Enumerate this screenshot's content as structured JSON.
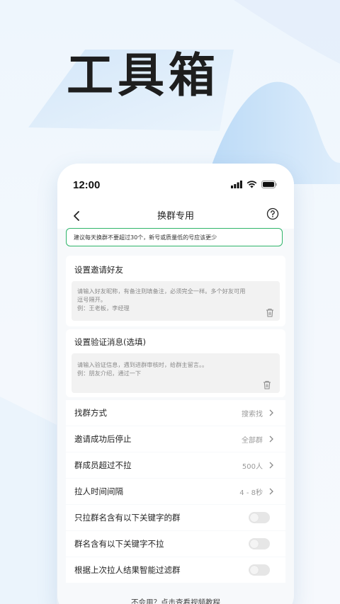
{
  "hero": {
    "title": "工具箱"
  },
  "status": {
    "time": "12:00"
  },
  "nav": {
    "title": "换群专用"
  },
  "notice": {
    "text": "建议每天换群不要超过30个，新号或质量低的号应该更少"
  },
  "invite": {
    "label": "设置邀请好友",
    "placeholder_line1": "请输入好友昵称，有备注则填备注，必须完全一样。多个好友可用",
    "placeholder_line2": "逗号隔开。",
    "placeholder_line3": "例：王老板，李经理"
  },
  "verify": {
    "label": "设置验证消息(选填)",
    "placeholder_line1": "请输入验证信息，遇到进群审核时，给群主留言。。",
    "placeholder_line2": "例：朋友介绍，通过一下"
  },
  "rows": [
    {
      "label": "找群方式",
      "value": "搜索找"
    },
    {
      "label": "邀请成功后停止",
      "value": "全部群"
    },
    {
      "label": "群成员超过不拉",
      "value": "500人"
    },
    {
      "label": "拉人时间间隔",
      "value": "4 - 8秒"
    }
  ],
  "toggles": [
    {
      "label": "只拉群名含有以下关键字的群",
      "on": false
    },
    {
      "label": "群名含有以下关键字不拉",
      "on": false
    },
    {
      "label": "根据上次拉人结果智能过滤群",
      "on": false
    }
  ],
  "footer": {
    "text": "不会用？点击查看视频教程"
  },
  "colors": {
    "accent": "#2fb56a",
    "background": "#eef6fd"
  }
}
